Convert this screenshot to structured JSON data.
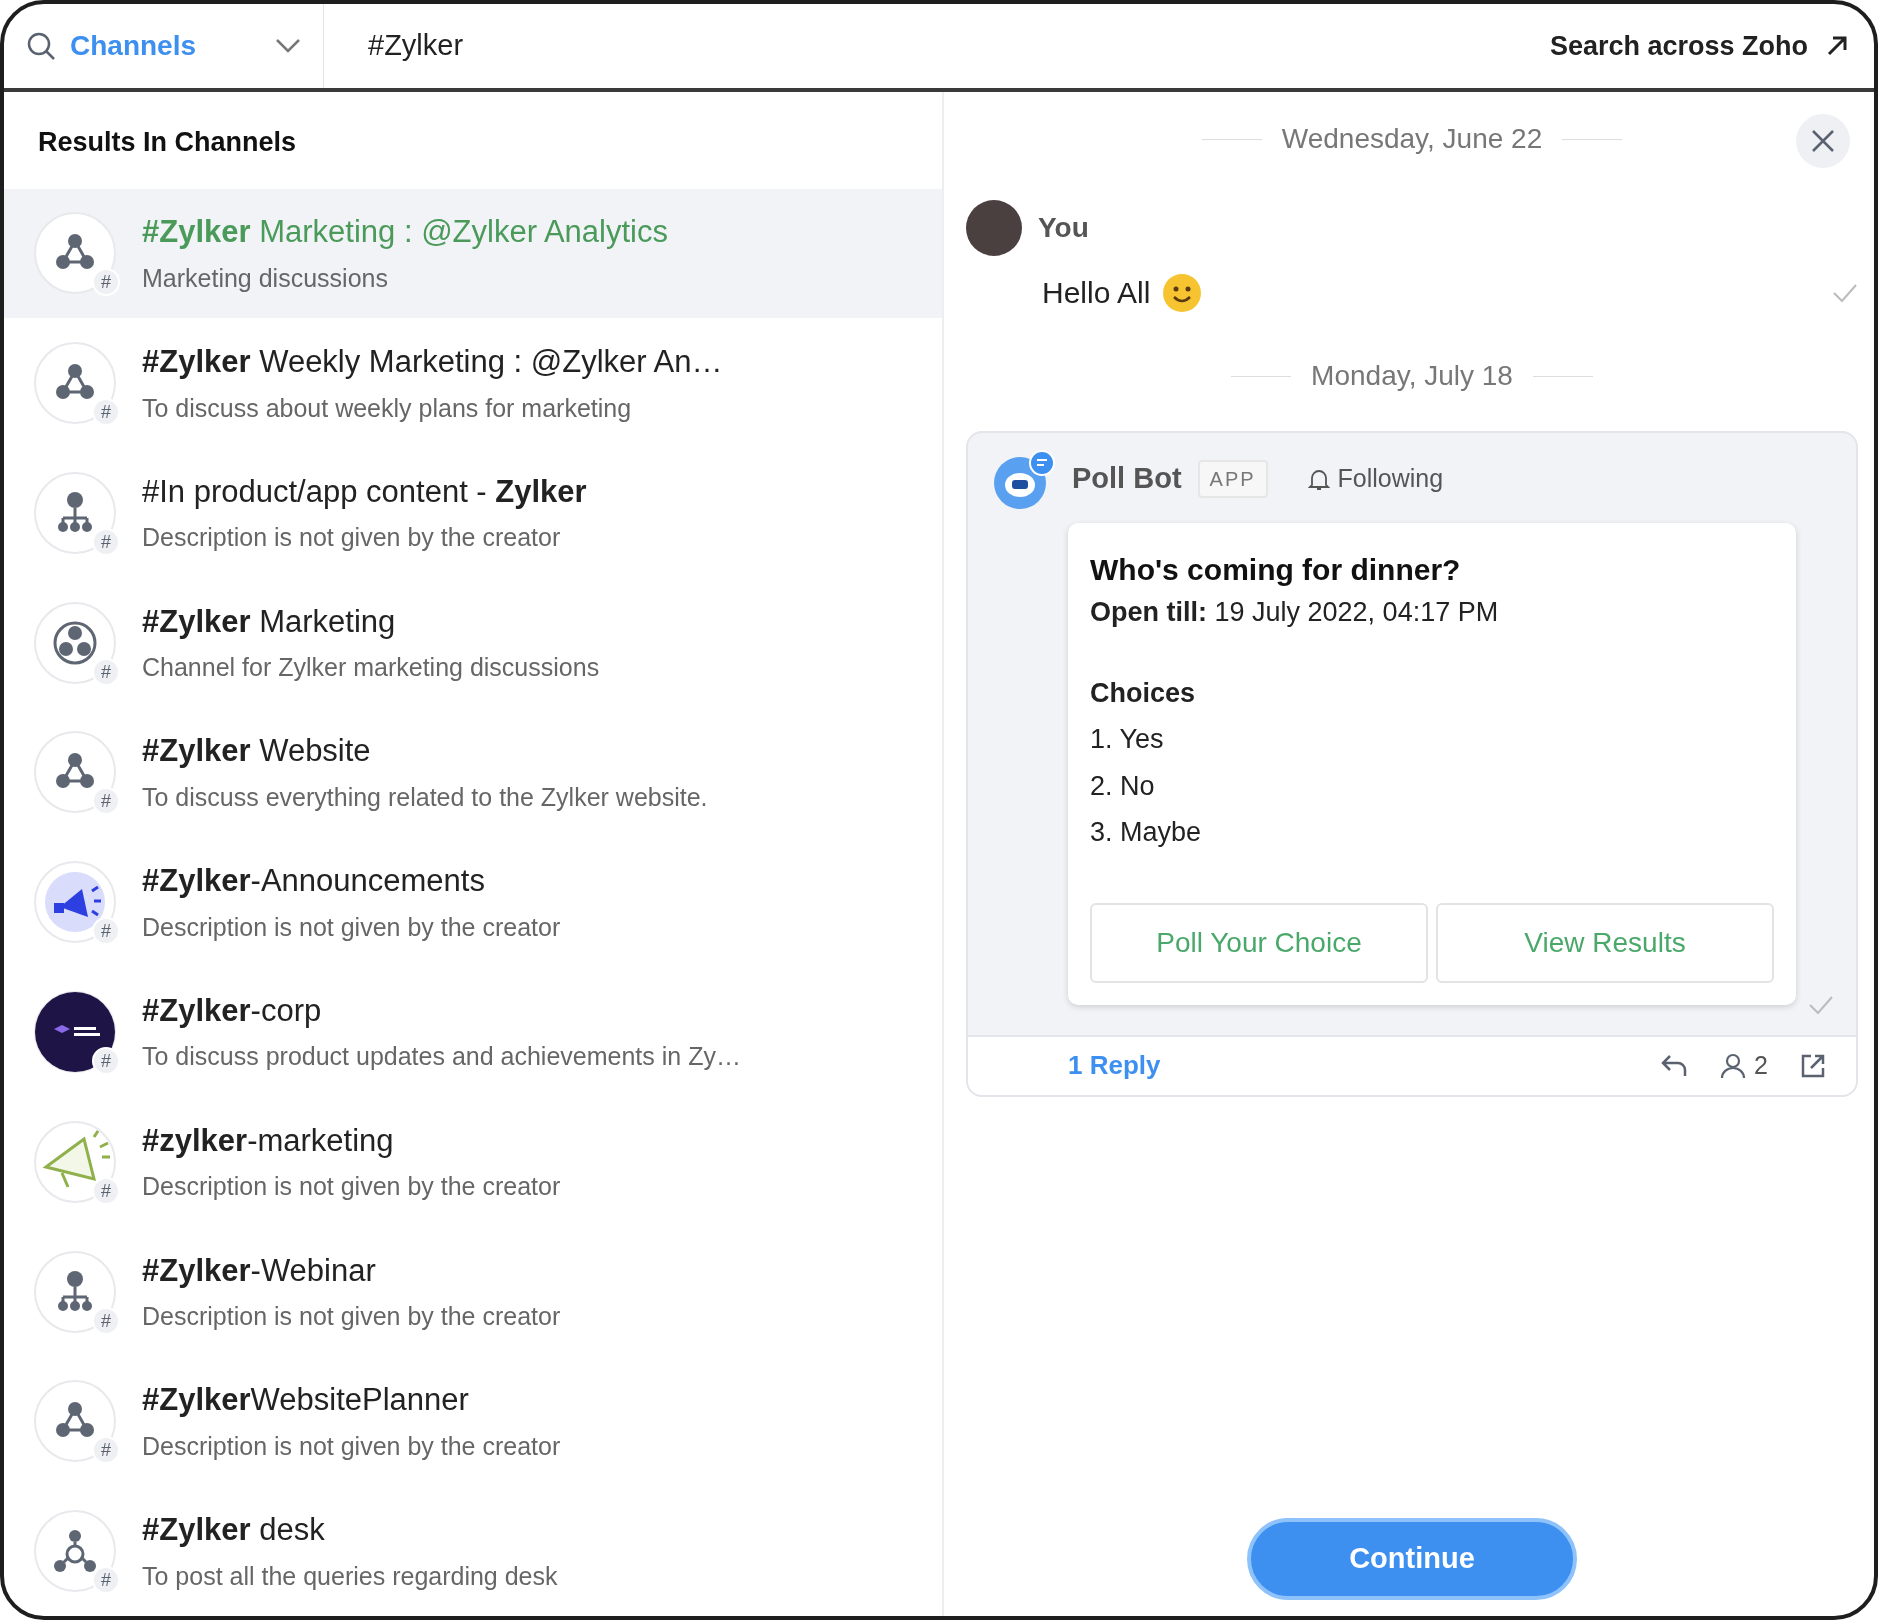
{
  "search_bar": {
    "scope": "Channels",
    "query": "#Zylker",
    "search_across": "Search across Zoho"
  },
  "results": {
    "heading": "Results In Channels",
    "items": [
      {
        "kind": "network",
        "badge": "#",
        "title": "**#Zylker** Marketing : @Zylker Analytics",
        "description": "Marketing discussions",
        "selected": true
      },
      {
        "kind": "network",
        "badge": "#",
        "title": "**#Zylker** Weekly Marketing : @Zylker An…",
        "description": "To discuss about weekly plans for marketing",
        "selected": false
      },
      {
        "kind": "hierarchy",
        "badge": "#",
        "title": "#In product/app content - **Zylker**",
        "description": "Description is not given by the creator",
        "selected": false
      },
      {
        "kind": "cluster",
        "badge": "#",
        "title": "**#Zylker** Marketing",
        "description": "Channel for Zylker marketing discussions",
        "selected": false
      },
      {
        "kind": "network",
        "badge": "#",
        "title": "**#Zylker** Website",
        "description": "To discuss everything related to the Zylker website.",
        "selected": false
      },
      {
        "kind": "announce",
        "badge": "#",
        "title": "**#Zylker**-Announcements",
        "description": "Description is not given by the creator",
        "selected": false
      },
      {
        "kind": "corp",
        "badge": "#",
        "title": "**#Zylker**-corp",
        "description": "To discuss product updates and achievements in Zy…",
        "selected": false
      },
      {
        "kind": "megaphone",
        "badge": "#",
        "title": "**#zylker**-marketing",
        "description": "Description is not given by the creator",
        "selected": false
      },
      {
        "kind": "hierarchy",
        "badge": "#",
        "title": "**#Zylker**-Webinar",
        "description": "Description is not given by the creator",
        "selected": false
      },
      {
        "kind": "network",
        "badge": "#",
        "title": "**#Zylker**WebsitePlanner",
        "description": "Description is not given by the creator",
        "selected": false
      },
      {
        "kind": "hub",
        "badge": "#",
        "title": "**#Zylker** desk",
        "description": "To post all the queries regarding desk",
        "selected": false
      }
    ]
  },
  "preview": {
    "dates": [
      "Wednesday, June 22",
      "Monday, July 18"
    ],
    "message": {
      "sender": "You",
      "text": "Hello All"
    },
    "poll": {
      "bot_name": "Poll Bot",
      "tag": "APP",
      "follow": "Following",
      "question": "Who's coming for dinner?",
      "open_till": "**Open till:** 19 July 2022, 04:17 PM",
      "choices_heading": "Choices",
      "choices": [
        "1. Yes",
        "2. No",
        "3. Maybe"
      ],
      "buttons": [
        "Poll Your Choice",
        "View Results"
      ],
      "replies": "1 Reply",
      "participants": "2"
    },
    "continue": "Continue"
  }
}
